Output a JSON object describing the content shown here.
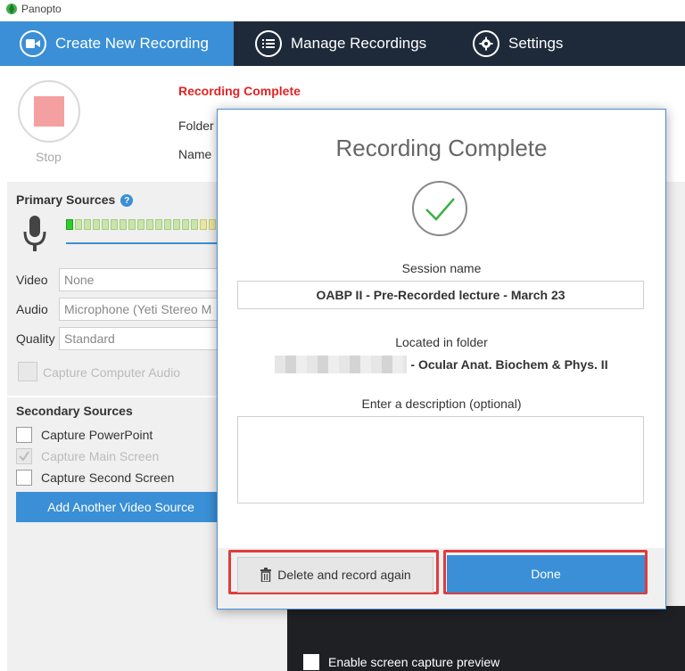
{
  "window": {
    "title": "Panopto"
  },
  "nav": {
    "create": "Create New Recording",
    "manage": "Manage Recordings",
    "settings": "Settings"
  },
  "recorder": {
    "stop_label": "Stop",
    "status": "Recording Complete",
    "folder_label": "Folder",
    "name_label": "Name"
  },
  "primary": {
    "title": "Primary Sources",
    "video_label": "Video",
    "video_value": "None",
    "audio_label": "Audio",
    "audio_value": "Microphone (Yeti Stereo M",
    "quality_label": "Quality",
    "quality_value": "Standard",
    "capture_audio": "Capture Computer Audio"
  },
  "secondary": {
    "title": "Secondary Sources",
    "items": [
      {
        "label": "Capture PowerPoint",
        "checked": false,
        "disabled": false
      },
      {
        "label": "Capture Main Screen",
        "checked": true,
        "disabled": true
      },
      {
        "label": "Capture Second Screen",
        "checked": false,
        "disabled": false
      }
    ],
    "add_button": "Add Another Video Source"
  },
  "preview": {
    "label": "Enable screen capture preview"
  },
  "modal": {
    "title": "Recording Complete",
    "session_label": "Session name",
    "session_value": "OABP II - Pre-Recorded lecture - March 23",
    "folder_label": "Located in folder",
    "folder_value": "- Ocular Anat. Biochem & Phys. II",
    "desc_label": "Enter a description (optional)",
    "desc_value": "",
    "delete_button": "Delete and record again",
    "done_button": "Done"
  },
  "colors": {
    "accent": "#3a8fd6",
    "nav_bg": "#1e2a3a",
    "status_red": "#e02424",
    "highlight": "#e23b3b"
  }
}
